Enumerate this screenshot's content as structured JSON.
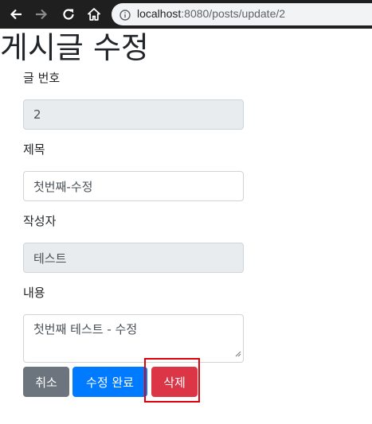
{
  "browser": {
    "url_host": "localhost",
    "url_path": ":8080/posts/update/2",
    "icons": [
      "back-arrow-icon",
      "forward-arrow-icon",
      "reload-icon",
      "home-icon",
      "info-icon"
    ]
  },
  "page": {
    "title": "게시글 수정"
  },
  "form": {
    "id": {
      "label": "글 번호",
      "value": "2"
    },
    "title": {
      "label": "제목",
      "value": "첫번째-수정"
    },
    "author": {
      "label": "작성자",
      "value": "테스트"
    },
    "content": {
      "label": "내용",
      "value": "첫번째 테스트 - 수정"
    }
  },
  "buttons": {
    "cancel": "취소",
    "update": "수정 완료",
    "delete": "삭제"
  },
  "colors": {
    "cancel": "#6c757d",
    "update": "#007bff",
    "delete": "#dc3545",
    "highlight": "#e0000b"
  }
}
